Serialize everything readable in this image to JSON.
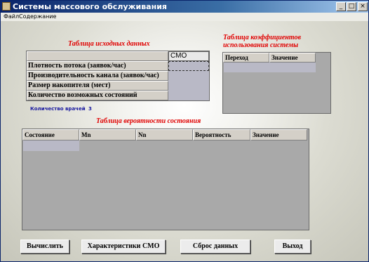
{
  "window": {
    "title": "Системы массового обслуживания"
  },
  "titlebar_buttons": {
    "minimize": "_",
    "maximize": "□",
    "close": "×"
  },
  "menu": [
    "Файл",
    "Содержание"
  ],
  "source_table": {
    "title": "Таблица исходных данных",
    "column_header": "СМО",
    "rows": [
      "Плотность потока (заявок/час)",
      "Производительность канала (заявок/час)",
      "Размер накопителя (мест)",
      "Количество возможных состояний"
    ]
  },
  "coef_table": {
    "title_line1": "Таблица коэффициентов",
    "title_line2": "использования системы",
    "columns": [
      "Переход",
      "Значение"
    ]
  },
  "doctors": {
    "label": "Количество врачей",
    "value": "3"
  },
  "prob_table": {
    "title": "Таблица вероятности состояния",
    "columns": [
      "Состояние",
      "Mn",
      "Nn",
      "Вероятность",
      "Значение"
    ]
  },
  "buttons": {
    "calculate": "Вычислить",
    "characteristics": "Характеристики СМО",
    "reset": "Сброс данных",
    "exit": "Выход"
  }
}
